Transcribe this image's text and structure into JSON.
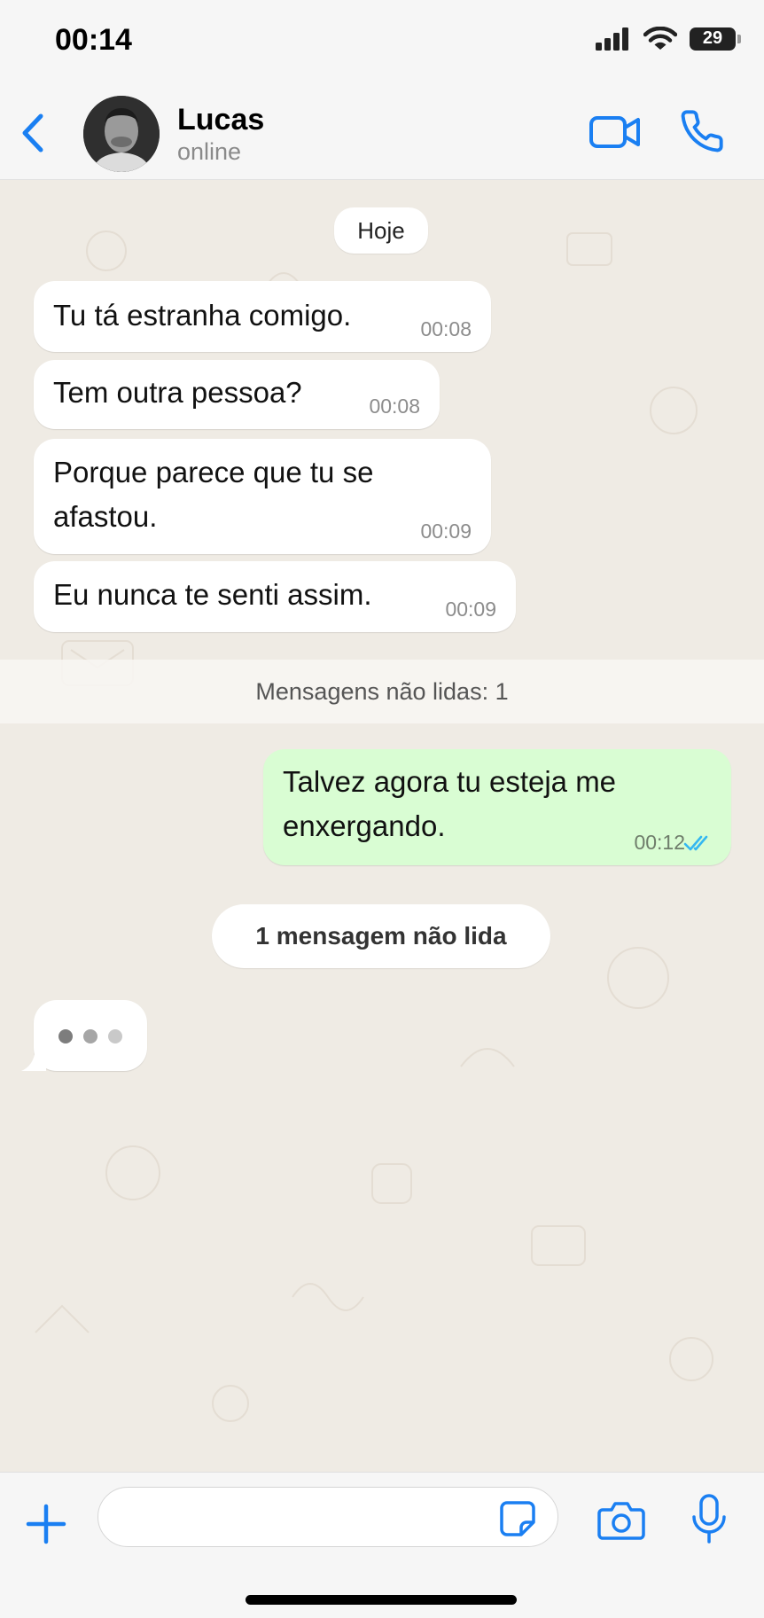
{
  "status_bar": {
    "time": "00:14",
    "battery": "29"
  },
  "header": {
    "contact_name": "Lucas",
    "contact_status": "online"
  },
  "chat": {
    "date_label": "Hoje",
    "incoming_messages": [
      {
        "lines": [
          "Tu tá estranha comigo."
        ],
        "time": "00:08"
      },
      {
        "lines": [
          "Tem outra pessoa?"
        ],
        "time": "00:08"
      },
      {
        "lines": [
          "Porque parece que tu se",
          "afastou."
        ],
        "time": "00:09"
      },
      {
        "lines": [
          "Eu nunca te senti assim."
        ],
        "time": "00:09"
      }
    ],
    "unread_banner": "Mensagens não lidas: 1",
    "outgoing_message": {
      "lines": [
        "Talvez agora tu esteja me",
        "enxergando."
      ],
      "time": "00:12",
      "read": true
    },
    "unread_pill": "1 mensagem não lida"
  },
  "input_bar": {
    "message_value": ""
  },
  "colors": {
    "accent": "#1a7ff2",
    "outgoing_bubble": "#d9fdd3",
    "read_ticks": "#34b7f1"
  }
}
